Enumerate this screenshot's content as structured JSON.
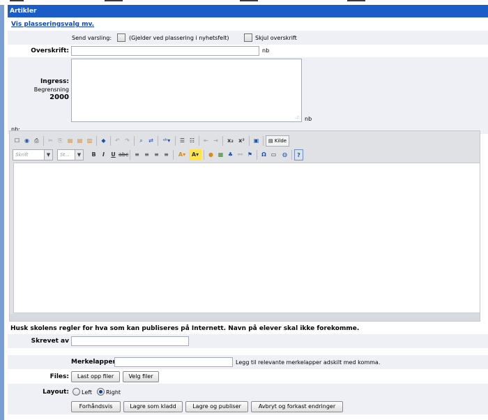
{
  "header": {
    "title": "Artikler"
  },
  "placement_link": "Vis plasseringsvalg mv.",
  "notify": {
    "label": "Send varsling:",
    "hint": "(Gjelder ved plassering i nyhetsfelt)",
    "hide_heading_label": "Skjul overskrift"
  },
  "heading": {
    "label": "Overskrift:",
    "value": "",
    "lang": "nb"
  },
  "ingress": {
    "label": "Ingress:",
    "limit_label": "Begrensning",
    "limit_value": "2000",
    "value": "",
    "lang": "nb"
  },
  "body_lang": "nb:",
  "toolbar": {
    "font_placeholder": "Skrift",
    "size_placeholder": "St...",
    "source_label": "Kilde"
  },
  "notice": "Husk skolens regler for hva som kan publiseres på Internett. Navn på elever skal ikke forekomme.",
  "author": {
    "label": "Skrevet av",
    "value": ""
  },
  "tags": {
    "label": "Merkelapper:",
    "value": "",
    "hint": "Legg til relevante merkelapper adskilt med komma."
  },
  "files": {
    "label": "Files:",
    "upload_button": "Last opp filer",
    "choose_button": "Velg filer"
  },
  "layout": {
    "label": "Layout:",
    "left_label": "Left",
    "right_label": "Right",
    "selected": "Right"
  },
  "actions": {
    "preview": "Forhåndsvis",
    "save_draft": "Lagre som kladd",
    "save_publish": "Lagre og publiser",
    "cancel": "Avbryt og forkast endringer"
  },
  "colors": {
    "header": "#1b5cc8",
    "link": "#1545b5",
    "band": "#eef0f5"
  }
}
